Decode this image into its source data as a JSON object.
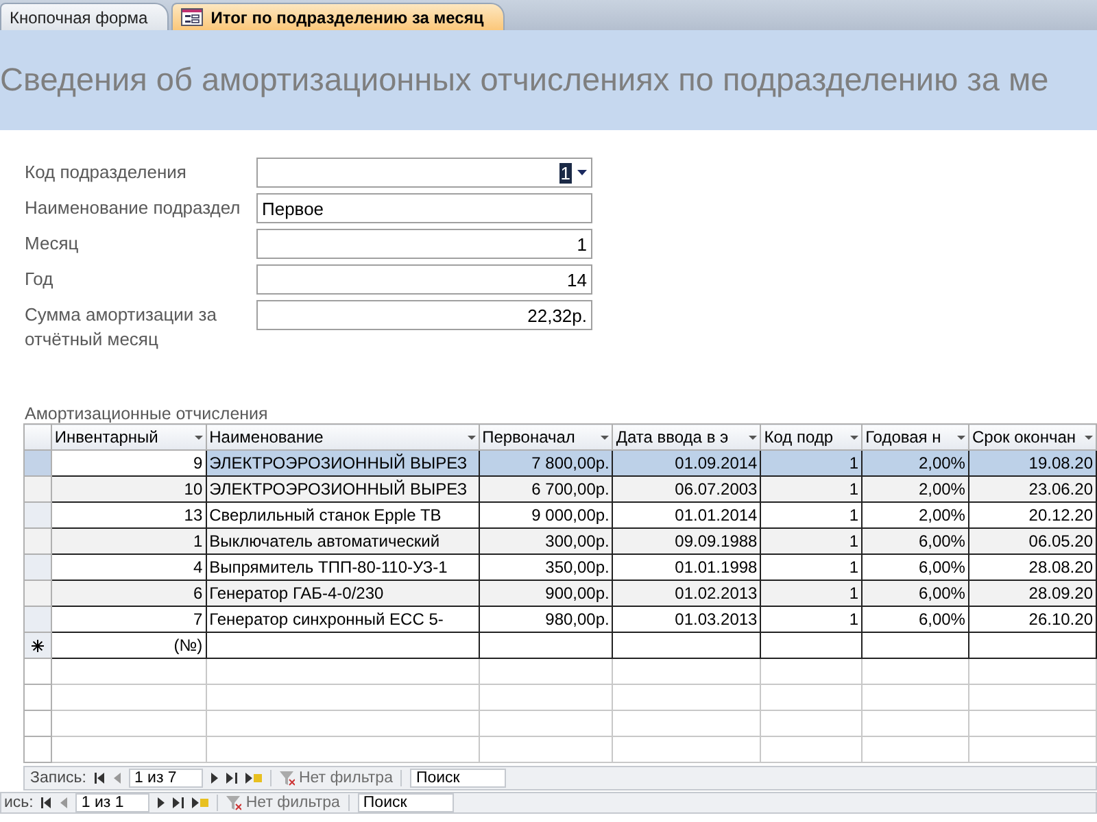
{
  "tabs": [
    {
      "label": "Кнопочная форма",
      "selected": false
    },
    {
      "label": "Итог по подразделению за месяц",
      "selected": true
    }
  ],
  "header": {
    "title": "Сведения об амортизационных отчислениях по подразделению за ме"
  },
  "fields": [
    {
      "label": "Код подразделения",
      "value": "1",
      "kind": "combo"
    },
    {
      "label": "Наименование подраздел",
      "value": "Первое",
      "kind": "text"
    },
    {
      "label": "Месяц",
      "value": "1",
      "kind": "number"
    },
    {
      "label": "Год",
      "value": "14",
      "kind": "number"
    },
    {
      "label": "Сумма амортизации за отчётный месяц",
      "value": "22,32р.",
      "kind": "number"
    }
  ],
  "subform": {
    "label": "Амортизационные отчисления",
    "columns": [
      "Инвентарный",
      "Наименование",
      "Первоначал",
      "Дата ввода в э",
      "Код подр",
      "Годовая н",
      "Срок окончан"
    ],
    "rows": [
      {
        "selected": true,
        "cells": [
          "9",
          "ЭЛЕКТРОЭРОЗИОННЫЙ ВЫРЕЗ",
          "7 800,00р.",
          "01.09.2014",
          "1",
          "2,00%",
          "19.08.20"
        ]
      },
      {
        "selected": false,
        "cells": [
          "10",
          "ЭЛЕКТРОЭРОЗИОННЫЙ ВЫРЕЗ",
          "6 700,00р.",
          "06.07.2003",
          "1",
          "2,00%",
          "23.06.20"
        ]
      },
      {
        "selected": false,
        "cells": [
          "13",
          "Сверлильный станок Epple TB",
          "9 000,00р.",
          "01.01.2014",
          "1",
          "2,00%",
          "20.12.20"
        ]
      },
      {
        "selected": false,
        "cells": [
          "1",
          "Выключатель автоматический",
          "300,00р.",
          "09.09.1988",
          "1",
          "6,00%",
          "06.05.20"
        ]
      },
      {
        "selected": false,
        "cells": [
          "4",
          "Выпрямитель ТПП-80-110-УЗ-1",
          "350,00р.",
          "01.01.1998",
          "1",
          "6,00%",
          "28.08.20"
        ]
      },
      {
        "selected": false,
        "cells": [
          "6",
          "Генератор ГАБ-4-0/230",
          "900,00р.",
          "01.02.2013",
          "1",
          "6,00%",
          "28.09.20"
        ]
      },
      {
        "selected": false,
        "cells": [
          "7",
          "Генератор синхронный ECC 5-",
          "980,00р.",
          "01.03.2013",
          "1",
          "6,00%",
          "26.10.20"
        ]
      }
    ],
    "new_row": "(№)",
    "navigator": {
      "label": "Запись:",
      "position": "1 из 7",
      "filter": "Нет фильтра",
      "search": "Поиск"
    }
  },
  "navigator": {
    "label": "ись:",
    "position": "1 из 1",
    "filter": "Нет фильтра",
    "search": "Поиск"
  }
}
